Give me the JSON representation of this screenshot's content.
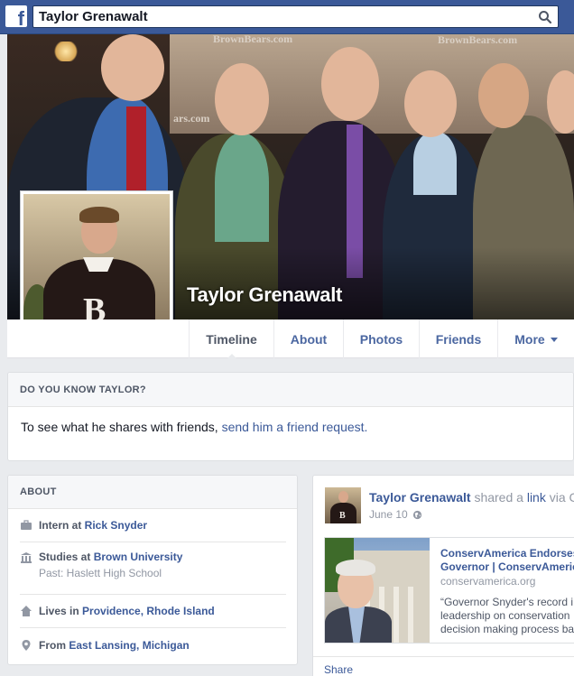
{
  "search": {
    "value": "Taylor Grenawalt"
  },
  "cover": {
    "wall_texts": [
      "BrownBears.com",
      "BrownBears.com",
      "ars.com"
    ]
  },
  "profile": {
    "name": "Taylor Grenawalt"
  },
  "nav": {
    "tabs": [
      {
        "label": "Timeline",
        "active": true
      },
      {
        "label": "About"
      },
      {
        "label": "Photos"
      },
      {
        "label": "Friends"
      },
      {
        "label": "More"
      }
    ]
  },
  "dyk": {
    "header": "DO YOU KNOW TAYLOR?",
    "text": "To see what he shares with friends, ",
    "link": "send him a friend request."
  },
  "about": {
    "header": "ABOUT",
    "work": {
      "prefix": "Intern at ",
      "place": "Rick Snyder"
    },
    "education": {
      "prefix": "Studies at ",
      "place": "Brown University",
      "past": "Past: Haslett High School"
    },
    "lives": {
      "prefix": "Lives in ",
      "place": "Providence, Rhode Island"
    },
    "from": {
      "prefix": "From ",
      "place": "East Lansing, Michigan"
    }
  },
  "post": {
    "author": "Taylor Grenawalt",
    "action": " shared a ",
    "object": "link",
    "via": " via C",
    "date": "June 10",
    "share": {
      "title_line1": "ConservAmerica Endorses",
      "title_line2": "Governor | ConservAmeric",
      "domain": "conservamerica.org",
      "desc_line1": "“Governor Snyder's record i",
      "desc_line2": "leadership on conservation",
      "desc_line3": "decision making process ba"
    },
    "footer": {
      "share_label": "Share"
    }
  },
  "colors": {
    "brand": "#3b5998",
    "link": "#3b5998",
    "bg": "#e9ebee"
  }
}
